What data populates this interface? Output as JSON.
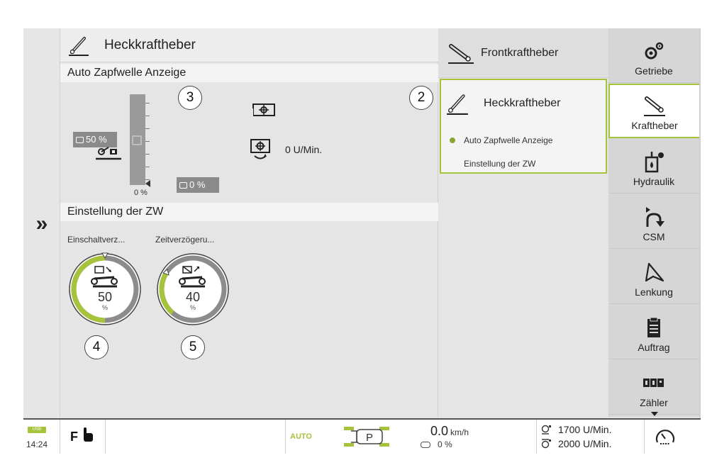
{
  "main": {
    "title": "Heckkraftheber",
    "section1_title": "Auto Zapfwelle Anzeige",
    "tag_upper": "50 %",
    "tag_lower": "0 %",
    "scale_min_label": "0 %",
    "pto_speed": "0 U/Min.",
    "section2_title": "Einstellung der ZW",
    "dials": [
      {
        "label": "Einschaltverz...",
        "value": "50",
        "unit": "%",
        "fill": 0.5
      },
      {
        "label": "Zeitverzögeru...",
        "value": "40",
        "unit": "%",
        "fill": 0.4
      }
    ]
  },
  "callouts": {
    "c2": "2",
    "c3": "3",
    "c4": "4",
    "c5": "5"
  },
  "overview": {
    "front_label": "Frontkraftheber",
    "rear_label": "Heckkraftheber",
    "items": [
      "Auto Zapfwelle Anzeige",
      "Einstellung der ZW"
    ]
  },
  "nav": {
    "items": [
      "Getriebe",
      "Kraftheber",
      "Hydraulik",
      "CSM",
      "Lenkung",
      "Auftrag",
      "Zähler"
    ],
    "active": "Kraftheber"
  },
  "status": {
    "usb": "USB",
    "time": "14:24",
    "f_label": "F",
    "auto": "AUTO",
    "park": "P",
    "speed": "0.0",
    "speed_unit": "km/h",
    "slip": "0 %",
    "rpm1": "1700 U/Min.",
    "rpm2": "2000 U/Min."
  },
  "colors": {
    "accent": "#a5c33b",
    "tag": "#8a8a8a"
  }
}
